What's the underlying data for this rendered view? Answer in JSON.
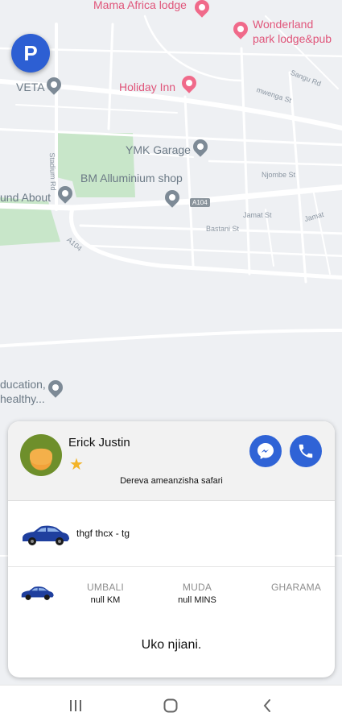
{
  "map": {
    "pois": {
      "mama_africa": "Mama Africa lodge",
      "wonderland_line1": "Wonderland",
      "wonderland_line2": "park lodge&pub",
      "veta": "VETA",
      "holiday_inn": "Holiday Inn",
      "ymk_garage": "YMK Garage",
      "bm_alluminium": "BM Alluminium shop",
      "und_about": "und About",
      "education_line1": "ducation,",
      "education_line2": "healthy..."
    },
    "streets": {
      "sangu": "Sangu Rd",
      "mwenga": "mwenga St",
      "njombe": "Njombe St",
      "jamat1": "Jamat St",
      "jamat2": "Jamat",
      "bastani": "Bastani St",
      "stadium": "Stadium Rd",
      "a104": "A104",
      "shield": "A104"
    },
    "parking_label": "P"
  },
  "driver": {
    "name": "Erick Justin",
    "rating_icon": "star-icon",
    "status": "Dereva ameanzisha safari"
  },
  "vehicle": {
    "plate": "thgf thcx - tg",
    "icon": "car-icon"
  },
  "stats": {
    "distance_label": "UMBALI",
    "distance_value": "null KM",
    "time_label": "MUDA",
    "time_value": "null MINS",
    "fare_label": "GHARAMA"
  },
  "ride_status": "Uko njiani.",
  "colors": {
    "accent": "#2f63d6",
    "star": "#f3b428",
    "poi_pink": "#e0557a",
    "park_green": "#c8e6c9"
  }
}
